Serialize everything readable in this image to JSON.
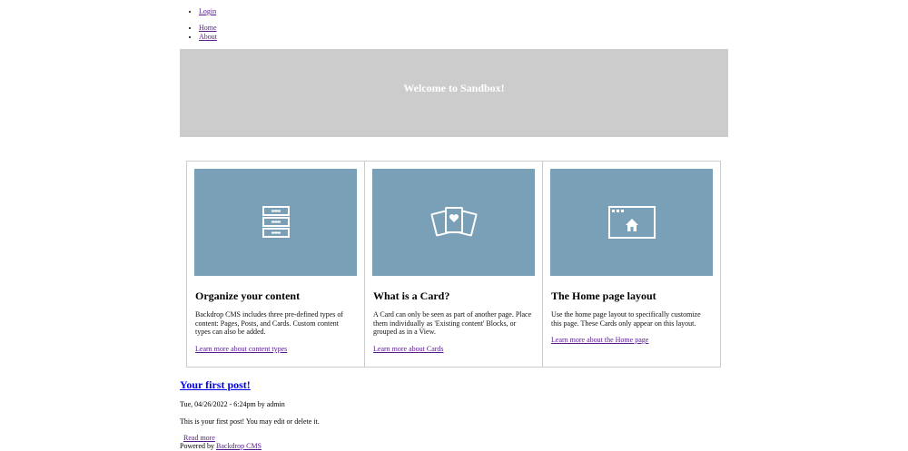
{
  "user_menu": {
    "items": [
      {
        "label": "Login"
      }
    ]
  },
  "main_menu": {
    "items": [
      {
        "label": "Home"
      },
      {
        "label": "About"
      }
    ]
  },
  "hero": {
    "title": "Welcome to Sandbox!",
    "background": "#cccccc"
  },
  "cards": [
    {
      "icon": "file-cabinet-icon",
      "title": "Organize your content",
      "text": "Backdrop CMS includes three pre-defined types of content: Pages, Posts, and Cards. Custom content types can also be added.",
      "link": "Learn more about content types"
    },
    {
      "icon": "cards-heart-icon",
      "title": "What is a Card?",
      "text": "A Card can only be seen as part of another page. Place them individually as 'Existing content' Blocks, or grouped as in a View.",
      "link": "Learn more about Cards"
    },
    {
      "icon": "browser-home-icon",
      "title": "The Home page layout",
      "text": "Use the home page layout to specifically customize this page. These Cards only appear on this layout.",
      "link": "Learn more about the Home page"
    }
  ],
  "colors": {
    "card_image": "#7aa0b8",
    "link": "#0000ee",
    "visited_link": "#551a8b"
  },
  "post": {
    "title": "Your first post!",
    "meta": "Tue, 04/26/2022 - 6:24pm by admin",
    "body": "This is your first post! You may edit or delete it.",
    "read_more": "Read more"
  },
  "footer": {
    "prefix": "Powered by",
    "link": "Backdrop CMS"
  }
}
